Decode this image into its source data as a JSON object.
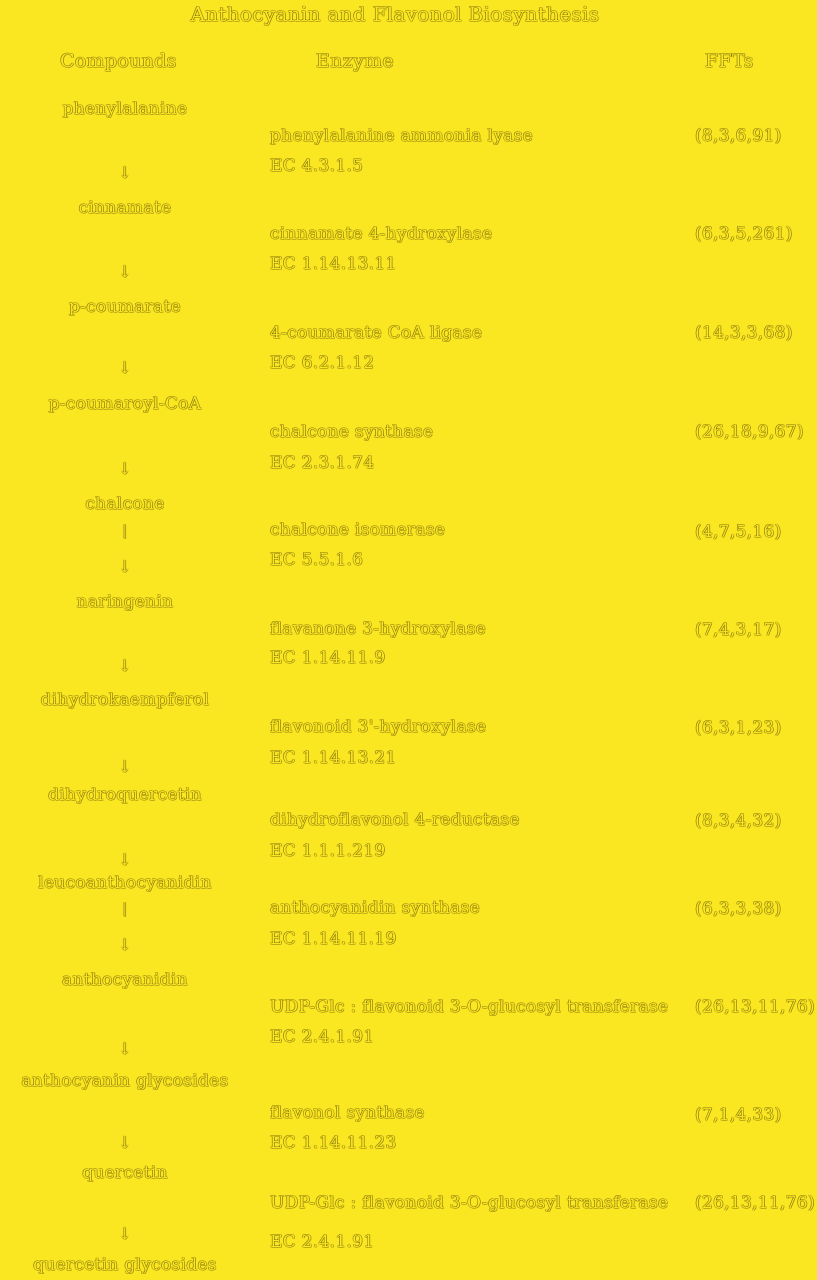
{
  "title": "Anthocyanin and Flavonol Biosynthesis",
  "headers": {
    "compounds": "Compounds",
    "enzyme": "Enzyme",
    "refs": "FFTs"
  },
  "compounds": [
    "phenylalanine",
    "cinnamate",
    "p-coumarate",
    "p-coumaroyl-CoA",
    "chalcone",
    "naringenin",
    "dihydrokaempferol",
    "dihydroquercetin",
    "leucoanthocyanidin",
    "anthocyanidin",
    "anthocyanin glycosides",
    "quercetin",
    "quercetin glycosides"
  ],
  "arrow_glyph": "↓",
  "tick_glyph": "|",
  "enzymes": [
    {
      "name": "phenylalanine ammonia lyase",
      "ec": "EC 4.3.1.5",
      "refs": "(8,3,6,91)"
    },
    {
      "name": "cinnamate 4-hydroxylase",
      "ec": "EC 1.14.13.11",
      "refs": "(6,3,5,261)"
    },
    {
      "name": "4-coumarate CoA ligase",
      "ec": "EC 6.2.1.12",
      "refs": "(14,3,3,68)"
    },
    {
      "name": "chalcone synthase",
      "ec": "EC 2.3.1.74",
      "refs": "(26,18,9,67)"
    },
    {
      "name": "chalcone isomerase",
      "ec": "EC 5.5.1.6",
      "refs": "(4,7,5,16)"
    },
    {
      "name": "flavanone 3-hydroxylase",
      "ec": "EC 1.14.11.9",
      "refs": "(7,4,3,17)"
    },
    {
      "name": "flavonoid 3'-hydroxylase",
      "ec": "EC 1.14.13.21",
      "refs": "(6,3,1,23)"
    },
    {
      "name": "dihydroflavonol 4-reductase",
      "ec": "EC 1.1.1.219",
      "refs": "(8,3,4,32)"
    },
    {
      "name": "anthocyanidin synthase",
      "ec": "EC 1.14.11.19",
      "refs": "(6,3,3,38)"
    },
    {
      "name": "UDP-Glc : flavonoid 3-O-glucosyl transferase",
      "ec": "EC 2.4.1.91",
      "refs": "(26,13,11,76)"
    },
    {
      "name": "flavonol synthase",
      "ec": "EC 1.14.11.23",
      "refs": "(7,1,4,33)"
    },
    {
      "name": "UDP-Glc : flavonoid 3-O-glucosyl transferase",
      "ec": "EC 2.4.1.91",
      "refs": "(26,13,11,76)"
    }
  ]
}
